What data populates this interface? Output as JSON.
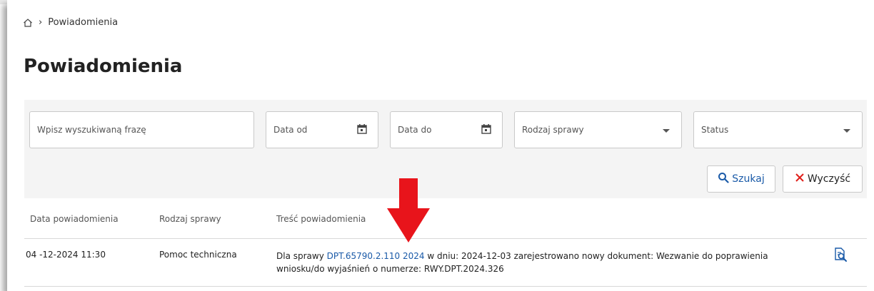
{
  "breadcrumb": {
    "current": "Powiadomienia"
  },
  "page": {
    "title": "Powiadomienia"
  },
  "filters": {
    "search_placeholder": "Wpisz wyszukiwaną frazę",
    "date_from": "Data od",
    "date_to": "Data do",
    "case_type": "Rodzaj sprawy",
    "status": "Status"
  },
  "buttons": {
    "search": "Szukaj",
    "clear": "Wyczyść"
  },
  "table": {
    "headers": [
      "Data powiadomienia",
      "Rodzaj sprawy",
      "Treść powiadomienia"
    ],
    "rows": [
      {
        "date": "04 -12-2024 11:30",
        "case_type": "Pomoc techniczna",
        "prefix": "Dla sprawy ",
        "link": "DPT.65790.2.110 2024",
        "suffix": " w dniu: 2024-12-03 zarejestrowano nowy dokument: Wezwanie do poprawienia wniosku/do wyjaśnień o numerze: RWY.DPT.2024.326"
      }
    ]
  },
  "colors": {
    "accent": "#1a5aa8",
    "danger": "#e0201b",
    "arrow": "#e8141b"
  },
  "icons": [
    "home-icon",
    "calendar-icon",
    "search-icon",
    "close-icon",
    "view-document-icon",
    "down-arrow-annotation"
  ]
}
